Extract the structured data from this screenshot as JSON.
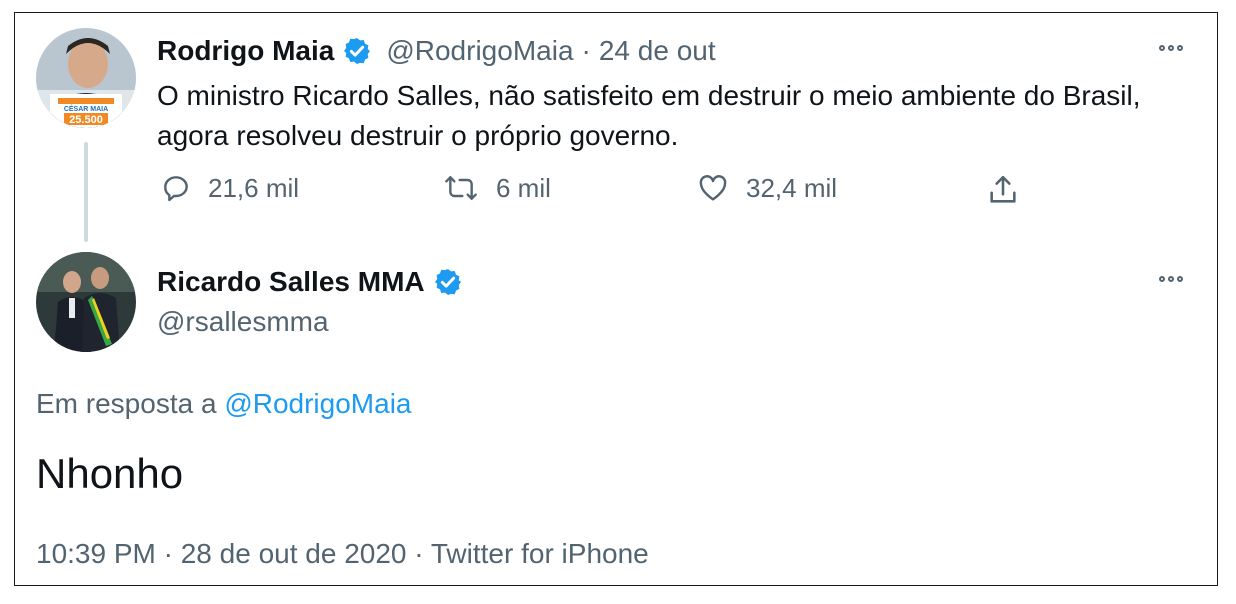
{
  "colors": {
    "text": "#0f1419",
    "muted": "#536471",
    "verified": "#1d9bf0",
    "link": "#1d9bf0",
    "thread": "#cfd9de"
  },
  "tweet1": {
    "author_name": "Rodrigo Maia",
    "handle": "@RodrigoMaia",
    "date_sep": "·",
    "date": "24 de out",
    "text": "O ministro Ricardo Salles, não satisfeito em destruir o meio ambiente do Brasil, agora resolveu destruir o próprio governo.",
    "reply_count": "21,6 mil",
    "retweet_count": "6 mil",
    "like_count": "32,4 mil",
    "avatar_badge_small": "CÉSAR MAIA",
    "avatar_badge_number": "25.500",
    "icons": [
      "reply-icon",
      "retweet-icon",
      "like-icon",
      "share-icon",
      "more-icon",
      "verified-badge-icon"
    ]
  },
  "tweet2": {
    "author_name": "Ricardo Salles MMA",
    "handle": "@rsallesmma",
    "reply_prefix": "Em resposta a",
    "reply_to": "@RodrigoMaia",
    "text": "Nhonho",
    "timestamp": "10:39 PM · 28 de out de 2020 · Twitter for iPhone",
    "icons": [
      "verified-badge-icon",
      "more-icon"
    ]
  }
}
